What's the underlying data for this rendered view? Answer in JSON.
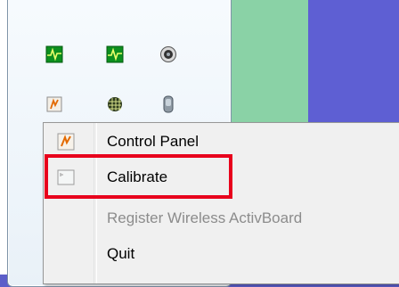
{
  "tray": {
    "icons": [
      {
        "name": "heartbeat-monitor-icon-1"
      },
      {
        "name": "heartbeat-monitor-icon-2"
      },
      {
        "name": "speaker-icon"
      },
      {
        "name": "activboard-icon"
      },
      {
        "name": "grid-device-icon"
      },
      {
        "name": "pen-device-icon"
      }
    ]
  },
  "context_menu": {
    "items": [
      {
        "label": "Control Panel",
        "icon": "activboard-icon",
        "enabled": true
      },
      {
        "label": "Calibrate",
        "icon": "calibrate-icon",
        "enabled": true
      },
      {
        "label": "Register Wireless ActivBoard",
        "icon": "",
        "enabled": false
      },
      {
        "label": "Quit",
        "icon": "",
        "enabled": true
      }
    ]
  },
  "colors": {
    "highlight": "#e8001c",
    "disabled_text": "#8c8c8c",
    "desktop_green": "#8ad2a6",
    "desktop_blue": "#5e5fd3"
  }
}
